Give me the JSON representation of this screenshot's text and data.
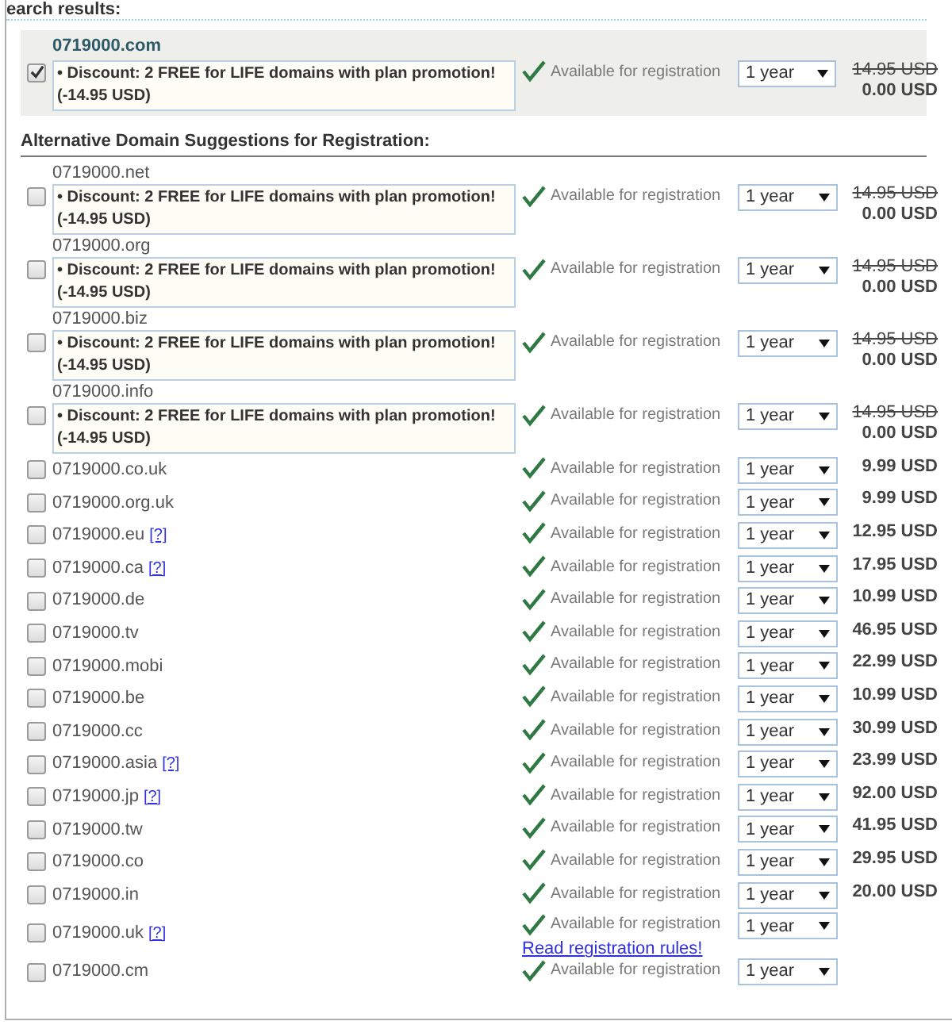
{
  "heading": "earch results:",
  "main": {
    "domain": "0719000.com",
    "checked": true,
    "promo": "• Discount: 2 FREE for LIFE domains with plan promotion! (-14.95 USD)",
    "status": "Available for registration",
    "period": "1 year",
    "old_price": "14.95 USD",
    "price": "0.00 USD"
  },
  "alt_heading": "Alternative Domain Suggestions for Registration:",
  "suggestions": [
    {
      "kind": "promo",
      "domain": "0719000.net",
      "checked": false,
      "promo": "• Discount: 2 FREE for LIFE domains with plan promotion! (-14.95 USD)",
      "status": "Available for registration",
      "period": "1 year",
      "old_price": "14.95 USD",
      "price": "0.00 USD"
    },
    {
      "kind": "promo",
      "domain": "0719000.org",
      "checked": false,
      "promo": "• Discount: 2 FREE for LIFE domains with plan promotion! (-14.95 USD)",
      "status": "Available for registration",
      "period": "1 year",
      "old_price": "14.95 USD",
      "price": "0.00 USD"
    },
    {
      "kind": "promo",
      "domain": "0719000.biz",
      "checked": false,
      "promo": "• Discount: 2 FREE for LIFE domains with plan promotion! (-14.95 USD)",
      "status": "Available for registration",
      "period": "1 year",
      "old_price": "14.95 USD",
      "price": "0.00 USD"
    },
    {
      "kind": "promo",
      "domain": "0719000.info",
      "checked": false,
      "promo": "• Discount: 2 FREE for LIFE domains with plan promotion! (-14.95 USD)",
      "status": "Available for registration",
      "period": "1 year",
      "old_price": "14.95 USD",
      "price": "0.00 USD"
    },
    {
      "kind": "plain",
      "domain": "0719000.co.uk",
      "checked": false,
      "status": "Available for registration",
      "period": "1 year",
      "price": "9.99 USD"
    },
    {
      "kind": "plain",
      "domain": "0719000.org.uk",
      "checked": false,
      "status": "Available for registration",
      "period": "1 year",
      "price": "9.99 USD"
    },
    {
      "kind": "plain",
      "domain": "0719000.eu",
      "help": "[?]",
      "checked": false,
      "status": "Available for registration",
      "period": "1 year",
      "price": "12.95 USD"
    },
    {
      "kind": "plain",
      "domain": "0719000.ca",
      "help": "[?]",
      "checked": false,
      "status": "Available for registration",
      "period": "1 year",
      "price": "17.95 USD"
    },
    {
      "kind": "plain",
      "domain": "0719000.de",
      "checked": false,
      "status": "Available for registration",
      "period": "1 year",
      "price": "10.99 USD"
    },
    {
      "kind": "plain",
      "domain": "0719000.tv",
      "checked": false,
      "status": "Available for registration",
      "period": "1 year",
      "price": "46.95 USD"
    },
    {
      "kind": "plain",
      "domain": "0719000.mobi",
      "checked": false,
      "status": "Available for registration",
      "period": "1 year",
      "price": "22.99 USD"
    },
    {
      "kind": "plain",
      "domain": "0719000.be",
      "checked": false,
      "status": "Available for registration",
      "period": "1 year",
      "price": "10.99 USD"
    },
    {
      "kind": "plain",
      "domain": "0719000.cc",
      "checked": false,
      "status": "Available for registration",
      "period": "1 year",
      "price": "30.99 USD"
    },
    {
      "kind": "plain",
      "domain": "0719000.asia",
      "help": "[?]",
      "checked": false,
      "status": "Available for registration",
      "period": "1 year",
      "price": "23.99 USD"
    },
    {
      "kind": "plain",
      "domain": "0719000.jp",
      "help": "[?]",
      "checked": false,
      "status": "Available for registration",
      "period": "1 year",
      "price": "92.00 USD"
    },
    {
      "kind": "plain",
      "domain": "0719000.tw",
      "checked": false,
      "status": "Available for registration",
      "period": "1 year",
      "price": "41.95 USD"
    },
    {
      "kind": "plain",
      "domain": "0719000.co",
      "checked": false,
      "status": "Available for registration",
      "period": "1 year",
      "price": "29.95 USD"
    },
    {
      "kind": "plain",
      "domain": "0719000.in",
      "checked": false,
      "status": "Available for registration",
      "period": "1 year",
      "price": "20.00 USD"
    },
    {
      "kind": "plain",
      "domain": "0719000.uk",
      "help": "[?]",
      "checked": false,
      "status": "Available for registration",
      "rules_link": "Read registration rules!",
      "period": "1 year"
    },
    {
      "kind": "plain",
      "domain": "0719000.cm",
      "checked": false,
      "status": "Available for registration",
      "period": "1 year"
    }
  ]
}
